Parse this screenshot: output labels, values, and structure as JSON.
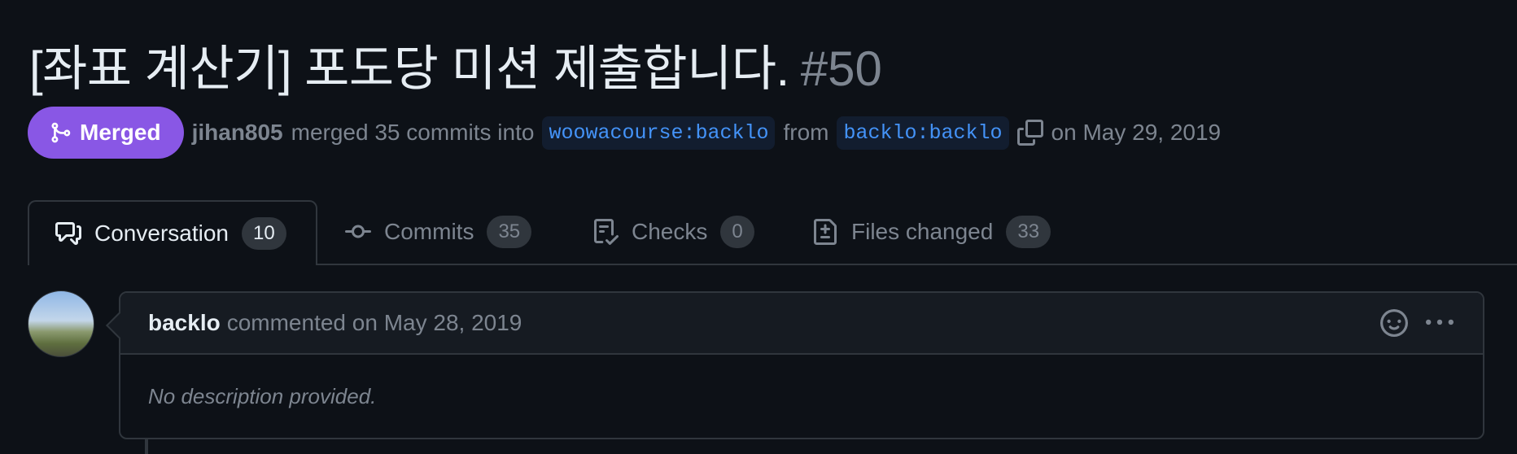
{
  "pr": {
    "title": "[좌표 계산기] 포도당 미션 제출합니다.",
    "number": "#50"
  },
  "meta": {
    "state_label": "Merged",
    "author": "jihan805",
    "action_text": "merged 35 commits into",
    "base_branch": "woowacourse:backlo",
    "from_text": "from",
    "head_branch": "backlo:backlo",
    "date_text": "on May 29, 2019"
  },
  "tabs": [
    {
      "label": "Conversation",
      "count": "10",
      "icon": "comment-discussion-icon",
      "active": true
    },
    {
      "label": "Commits",
      "count": "35",
      "icon": "git-commit-icon",
      "active": false
    },
    {
      "label": "Checks",
      "count": "0",
      "icon": "checklist-icon",
      "active": false
    },
    {
      "label": "Files changed",
      "count": "33",
      "icon": "file-diff-icon",
      "active": false
    }
  ],
  "comment": {
    "author": "backlo",
    "meta": "commented on May 28, 2019",
    "body": "No description provided."
  },
  "colors": {
    "background": "#0d1117",
    "merged_purple": "#8957e5",
    "branch_blue": "#4493f8",
    "muted_text": "#7d8590",
    "border": "#30363d"
  }
}
